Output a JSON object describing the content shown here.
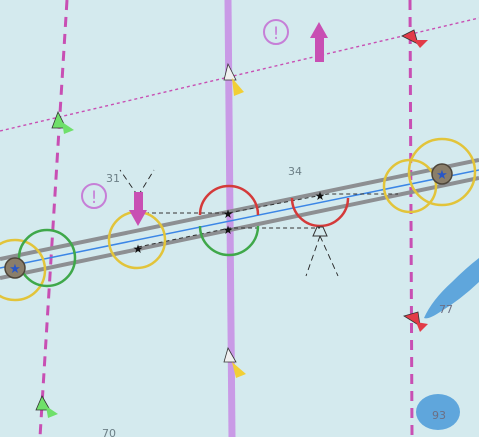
{
  "colors": {
    "water": "#d4eaee",
    "deep_blue": "#5fa6dc",
    "shallow": "#a8d1ef",
    "route_pink": "#c84fb3",
    "fairway_violet": "#c99ae6",
    "cable_gray": "#8d8f92",
    "centerline_blue": "#3b86e6",
    "sector_red": "#d43a3a",
    "sector_green": "#3fa84a",
    "sector_yellow": "#e2c43a",
    "buoy_red": "#e23b47",
    "buoy_green": "#6fe06a",
    "buoy_yellow": "#f2cf35",
    "platform_fill": "#8a7e6a",
    "caution_magenta": "#c67fd7"
  },
  "soundings": [
    "31",
    "34",
    "77",
    "93",
    "70"
  ],
  "symbols": {
    "caution": "!",
    "bridge_marker": "★"
  }
}
